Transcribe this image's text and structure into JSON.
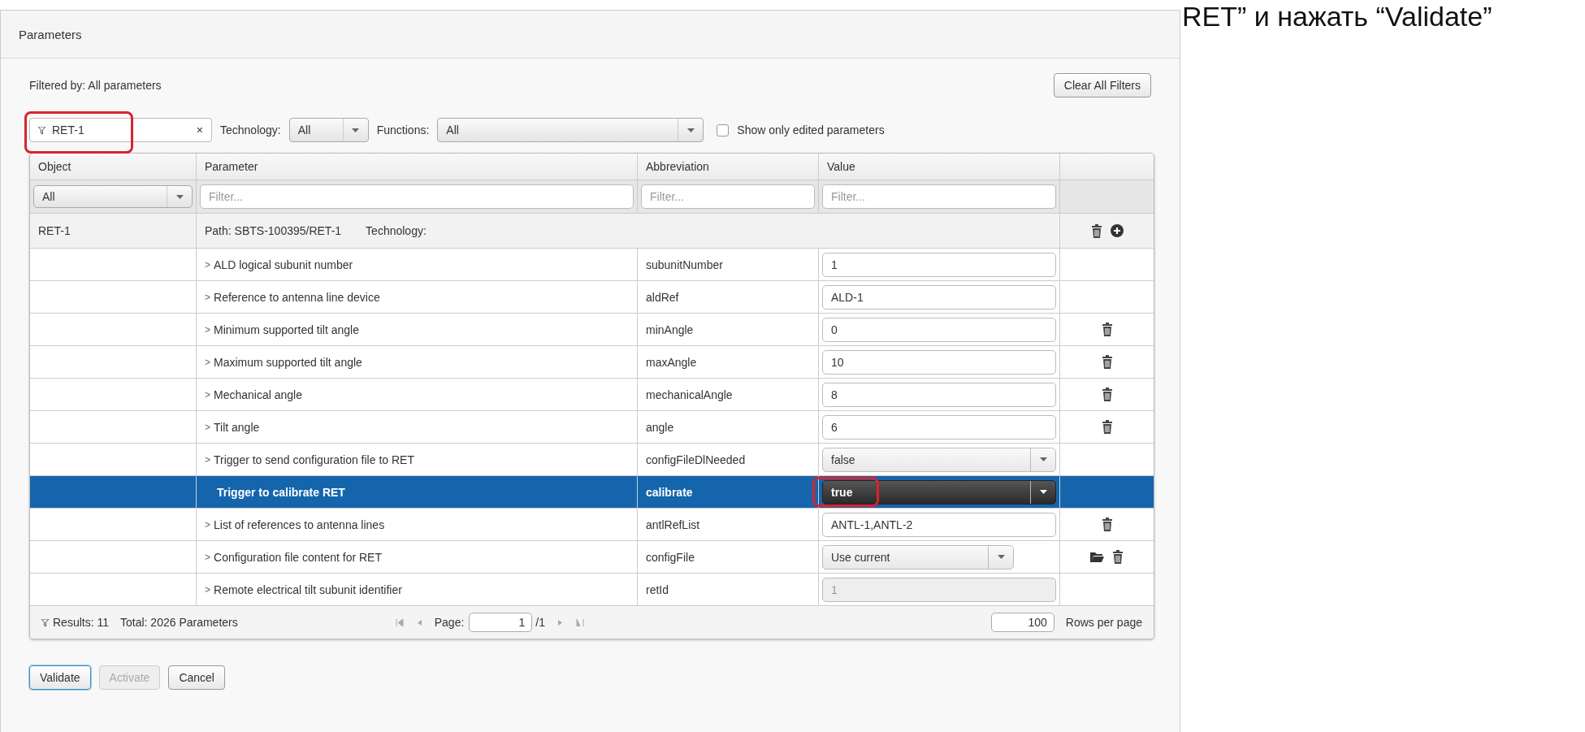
{
  "slide_text": "RET” и нажать “Validate”",
  "window": {
    "title": "Parameters"
  },
  "filtered_by": "Filtered by: All parameters",
  "clear_button": "Clear All Filters",
  "search": {
    "value": "RET-1",
    "clear": "×",
    "highlighted": true
  },
  "technology": {
    "label": "Technology:",
    "value": "All"
  },
  "functions": {
    "label": "Functions:",
    "value": "All"
  },
  "show_edited": {
    "label": "Show only edited parameters",
    "checked": false
  },
  "table": {
    "columns": [
      "Object",
      "Parameter",
      "Abbreviation",
      "Value"
    ],
    "column_filters": [
      {
        "kind": "select",
        "value": "All"
      },
      {
        "kind": "input",
        "placeholder": "Filter..."
      },
      {
        "kind": "input",
        "placeholder": "Filter..."
      },
      {
        "kind": "input",
        "placeholder": "Filter..."
      }
    ],
    "group": {
      "object": "RET-1",
      "path": "Path: SBTS-100395/RET-1",
      "technology": "Technology:",
      "actions": [
        {
          "kind": "delete"
        },
        {
          "kind": "add"
        }
      ]
    },
    "rows": [
      {
        "expander": ">",
        "parameter": "ALD logical subunit number",
        "abbreviation": "subunitNumber",
        "kind": "input",
        "value": "1",
        "selected": false,
        "highlighted": false,
        "actions": []
      },
      {
        "expander": ">",
        "parameter": "Reference to antenna line device",
        "abbreviation": "aldRef",
        "kind": "input",
        "value": "ALD-1",
        "selected": false,
        "highlighted": false,
        "actions": []
      },
      {
        "expander": ">",
        "parameter": "Minimum supported tilt angle",
        "abbreviation": "minAngle",
        "kind": "input",
        "value": "0",
        "selected": false,
        "highlighted": false,
        "actions": [
          {
            "kind": "delete"
          }
        ]
      },
      {
        "expander": ">",
        "parameter": "Maximum supported tilt angle",
        "abbreviation": "maxAngle",
        "kind": "input",
        "value": "10",
        "selected": false,
        "highlighted": false,
        "actions": [
          {
            "kind": "delete"
          }
        ]
      },
      {
        "expander": ">",
        "parameter": "Mechanical angle",
        "abbreviation": "mechanicalAngle",
        "kind": "input",
        "value": "8",
        "selected": false,
        "highlighted": false,
        "actions": [
          {
            "kind": "delete"
          }
        ]
      },
      {
        "expander": ">",
        "parameter": "Tilt angle",
        "abbreviation": "angle",
        "kind": "input",
        "value": "6",
        "selected": false,
        "highlighted": false,
        "actions": [
          {
            "kind": "delete"
          }
        ]
      },
      {
        "expander": ">",
        "parameter": "Trigger to send configuration file to RET",
        "abbreviation": "configFileDlNeeded",
        "kind": "select",
        "value": "false",
        "selected": false,
        "highlighted": false,
        "actions": []
      },
      {
        "parameter": "Trigger to calibrate RET",
        "abbreviation": "calibrate",
        "kind": "select",
        "value": "true",
        "selected": true,
        "highlighted": true,
        "actions": []
      },
      {
        "expander": ">",
        "parameter": "List of references to antenna lines",
        "abbreviation": "antlRefList",
        "kind": "input",
        "value": "ANTL-1,ANTL-2",
        "selected": false,
        "highlighted": false,
        "actions": [
          {
            "kind": "delete"
          }
        ]
      },
      {
        "expander": ">",
        "parameter": "Configuration file content for RET",
        "abbreviation": "configFile",
        "kind": "short-select",
        "value": "Use current",
        "selected": false,
        "highlighted": false,
        "actions": [
          {
            "kind": "folder"
          },
          {
            "kind": "delete"
          }
        ]
      },
      {
        "expander": ">",
        "parameter": "Remote electrical tilt subunit identifier",
        "abbreviation": "retId",
        "kind": "disabled",
        "value": "1",
        "selected": false,
        "highlighted": false,
        "actions": []
      }
    ]
  },
  "footer": {
    "results": "Results: 11",
    "total": "Total: 2026 Parameters",
    "page_label": "Page:",
    "page": "1",
    "page_count": "/1",
    "rows_per_page": "100",
    "rows_per_page_label": "Rows per page"
  },
  "buttons": [
    {
      "label": "Validate",
      "focused": true,
      "disabled": false
    },
    {
      "label": "Activate",
      "focused": false,
      "disabled": true
    },
    {
      "label": "Cancel",
      "focused": false,
      "disabled": false
    }
  ]
}
